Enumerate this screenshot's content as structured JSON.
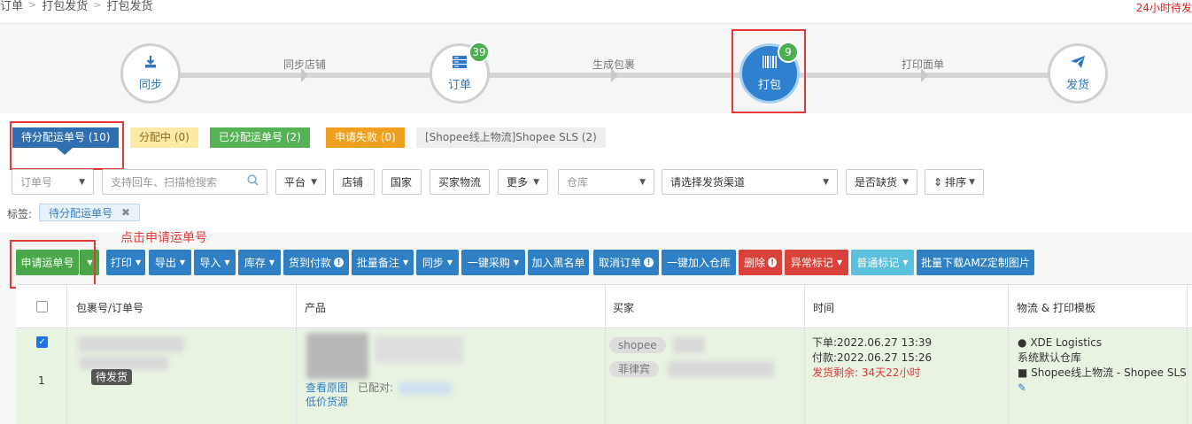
{
  "breadcrumb": [
    "订单",
    "打包发货",
    "打包发货"
  ],
  "top_note": "24小时待发",
  "steps": [
    {
      "label": "同步",
      "icon": "download-icon",
      "badge": ""
    },
    {
      "label": "订单",
      "icon": "server-icon",
      "badge": "39"
    },
    {
      "label": "打包",
      "icon": "barcode-icon",
      "badge": "9"
    },
    {
      "label": "发货",
      "icon": "paper-plane-icon",
      "badge": ""
    }
  ],
  "step_links": [
    "同步店铺",
    "生成包裹",
    "打印面单"
  ],
  "status_tabs": [
    {
      "label": "待分配运单号 (10)",
      "color": "#2f6fb0"
    },
    {
      "label": "分配中 (0)",
      "color": "#fde9a4"
    },
    {
      "label": "已分配运单号 (2)",
      "color": "#55b255"
    },
    {
      "label": "申请失败 (0)",
      "color": "#f0a020"
    },
    {
      "label": "[Shopee线上物流]Shopee SLS (2)",
      "color": "#eeeeee"
    }
  ],
  "filters": {
    "order_no": "订单号",
    "search_placeholder": "支持回车、扫描枪搜索",
    "platform": "平台",
    "shop": "店铺",
    "country": "国家",
    "buyer_logistics": "买家物流",
    "more": "更多",
    "warehouse": "仓库",
    "channel": "请选择发货渠道",
    "out_of_stock": "是否缺货",
    "sort": "排序"
  },
  "tag_label": "标签:",
  "tag_value": "待分配运单号",
  "hint": "点击申请运单号",
  "actions": {
    "apply_tracking": "申请运单号",
    "print": "打印",
    "export": "导出",
    "import": "导入",
    "stock": "库存",
    "cod": "货到付款",
    "batch_note": "批量备注",
    "sync": "同步",
    "one_click_purchase": "一键采购",
    "add_blacklist": "加入黑名单",
    "cancel_order": "取消订单",
    "add_warehouse": "一键加入仓库",
    "delete": "删除",
    "exception_mark": "异常标记",
    "normal_mark": "普通标记",
    "batch_download_amz": "批量下载AMZ定制图片"
  },
  "table": {
    "headers": [
      "包裹号/订单号",
      "产品",
      "买家",
      "时间",
      "物流 & 打印模板"
    ],
    "row": {
      "index": "1",
      "status": "待发货",
      "view_image": "查看原图",
      "matched": "已配对:",
      "cheap_source": "低价货源",
      "buyer_platform": "shopee",
      "buyer_country": "菲律宾",
      "order_time": "下单:2022.06.27 13:39",
      "pay_time": "付款:2022.06.27 15:26",
      "remaining": "发货剩余: 34天22小时",
      "logistics": "XDE Logistics",
      "warehouse": "系统默认仓库",
      "channel": "Shopee线上物流 - Shopee SLS"
    }
  }
}
